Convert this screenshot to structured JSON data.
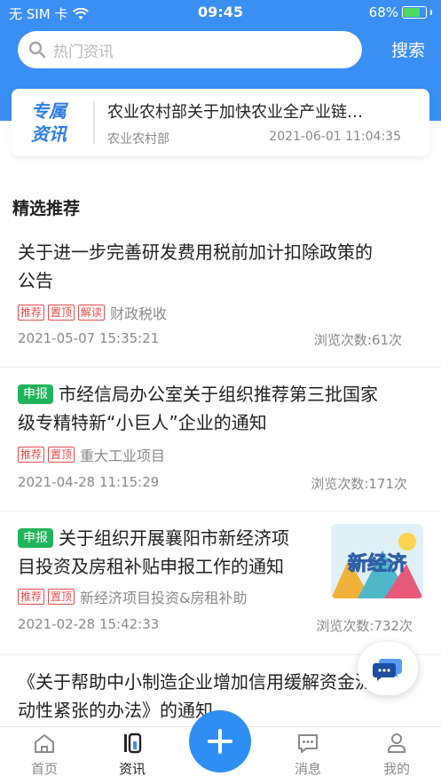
{
  "status_bar": {
    "carrier": "无 SIM 卡",
    "time": "09:45",
    "battery": "68%"
  },
  "search": {
    "placeholder": "热门资讯",
    "button": "搜索"
  },
  "featured": {
    "badge_line1": "专属",
    "badge_line2": "资讯",
    "title": "农业农村部关于加快农业全产业链…",
    "source": "农业农村部",
    "date": "2021-06-01 11:04:35"
  },
  "section_title": "精选推荐",
  "articles": [
    {
      "apply_tag": "",
      "title_line1": "关于进一步完善研发费用税前加计扣除政策的",
      "title_line2": "公告",
      "tags": [
        "推荐",
        "置顶",
        "解读"
      ],
      "category": "财政税收",
      "date": "2021-05-07 15:35:21",
      "views": "浏览次数:61次"
    },
    {
      "apply_tag": "申报",
      "title_line1": "市经信局办公室关于组织推荐第三批国家",
      "title_line2": "级专精特新“小巨人”企业的通知",
      "tags": [
        "推荐",
        "置顶"
      ],
      "category": "重大工业项目",
      "date": "2021-04-28 11:15:29",
      "views": "浏览次数:171次"
    },
    {
      "apply_tag": "申报",
      "title_line1": "关于组织开展襄阳市新经济项",
      "title_line2": "目投资及房租补贴申报工作的通知",
      "tags": [
        "推荐",
        "置顶"
      ],
      "category": "新经济项目投资&房租补助",
      "date": "2021-02-28 15:42:33",
      "views": "浏览次数:732次",
      "thumbnail_text": "新经济"
    },
    {
      "title_line1": "《关于帮助中小制造企业增加信用缓解资金流",
      "title_line2": "动性紧张的办法》的通知"
    }
  ],
  "tabbar": {
    "home": "首页",
    "news": "资讯",
    "messages": "消息",
    "mine": "我的"
  },
  "colors": {
    "brand_blue": "#3a8ff5",
    "apply_green": "#20b45a",
    "tag_red": "#e64b4b"
  }
}
